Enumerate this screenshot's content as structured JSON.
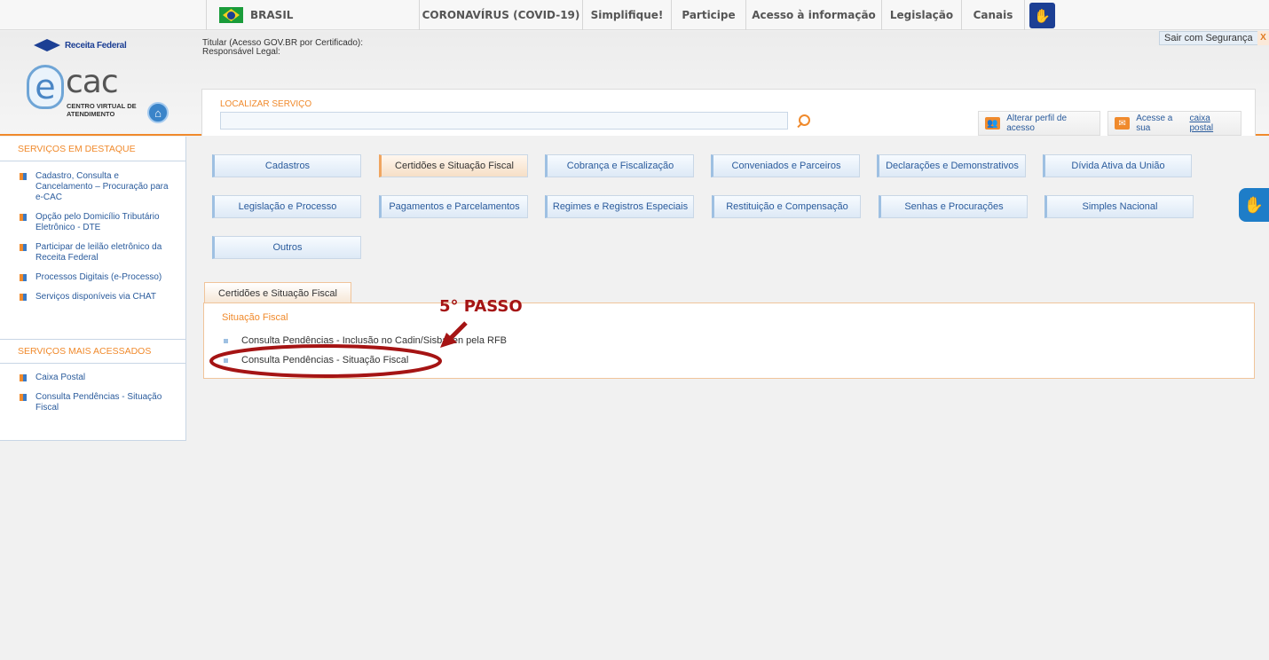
{
  "govbar": {
    "brasil": "BRASIL",
    "links": [
      "CORONAVÍRUS (COVID-19)",
      "Simplifique!",
      "Participe",
      "Acesso à informação",
      "Legislação",
      "Canais"
    ]
  },
  "header": {
    "rf_logo": "Receita Federal",
    "ecac_e": "e",
    "ecac_cac": "cac",
    "ecac_subtitle": "CENTRO VIRTUAL DE ATENDIMENTO",
    "titular": "Titular (Acesso GOV.BR por Certificado):",
    "responsavel": "Responsável Legal:",
    "logout": "Sair com Segurança",
    "logout_x": "X",
    "search_label": "LOCALIZAR SERVIÇO",
    "search_value": "",
    "alterar_perfil": "Alterar perfil de acesso",
    "caixa_prefix": "Acesse a sua",
    "caixa_link": "caixa postal"
  },
  "sidebar": {
    "destaque_title": "SERVIÇOS EM DESTAQUE",
    "destaque": [
      "Cadastro, Consulta e Cancelamento – Procuração para e-CAC",
      "Opção pelo Domicílio Tributário Eletrônico - DTE",
      "Participar de leilão eletrônico da Receita Federal",
      "Processos Digitais (e-Processo)",
      "Serviços disponíveis via CHAT"
    ],
    "acessados_title": "SERVIÇOS MAIS ACESSADOS",
    "acessados": [
      "Caixa Postal",
      "Consulta Pendências - Situação Fiscal"
    ]
  },
  "categories": [
    "Cadastros",
    "Certidões e Situação Fiscal",
    "Cobrança e Fiscalização",
    "Conveniados e Parceiros",
    "Declarações e Demonstrativos",
    "Dívida Ativa da União",
    "Legislação e Processo",
    "Pagamentos e Parcelamentos",
    "Regimes e Registros Especiais",
    "Restituição e Compensação",
    "Senhas e Procurações",
    "Simples Nacional",
    "Outros"
  ],
  "active_category": "Certidões e Situação Fiscal",
  "panel": {
    "tab": "Certidões e Situação Fiscal",
    "section_title": "Situação Fiscal",
    "services": [
      "Consulta Pendências - Inclusão no Cadin/Sisbacen pela RFB",
      "Consulta Pendências - Situação Fiscal"
    ]
  },
  "annotation": {
    "label": "5° PASSO",
    "color": "#a51414"
  },
  "colors": {
    "accent": "#f08a2c",
    "link": "#2a5b9c",
    "covid": "#d11a1a"
  }
}
